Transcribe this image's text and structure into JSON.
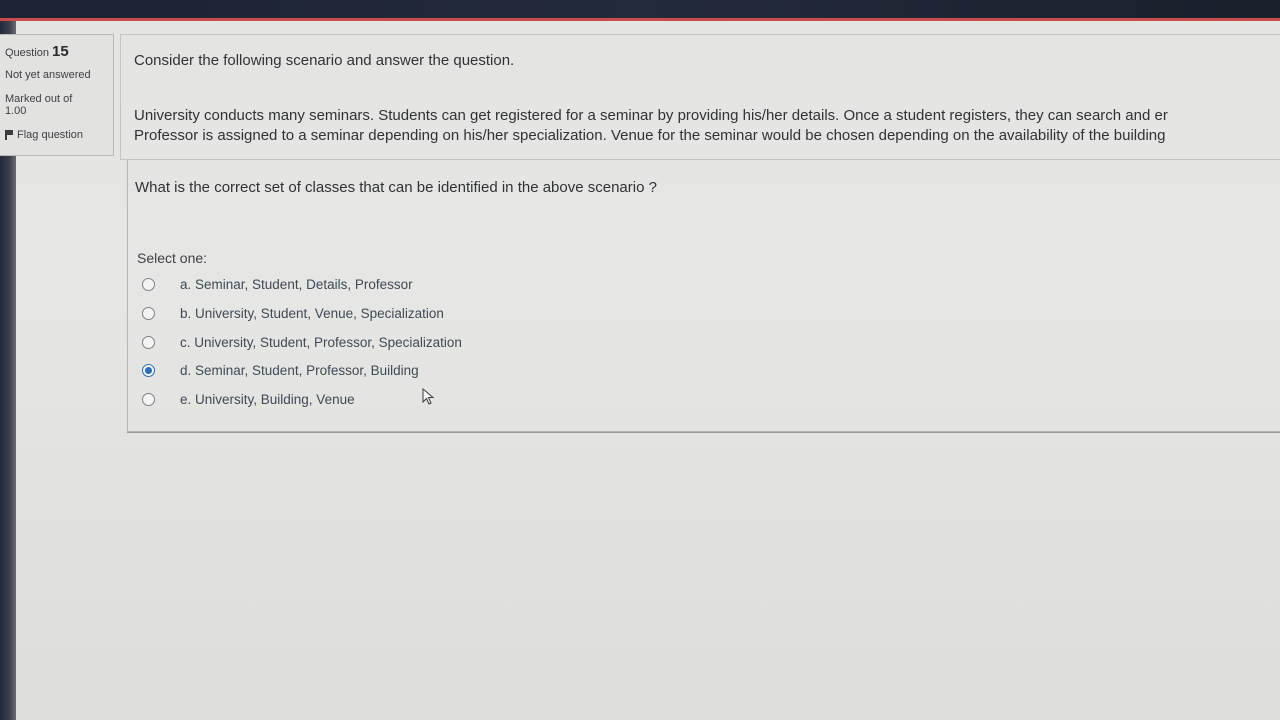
{
  "question_info": {
    "label": "Question",
    "number": "15",
    "status": "Not yet answered",
    "marked_line1": "Marked out of",
    "marked_line2": "1.00",
    "flag_label": "Flag question"
  },
  "question": {
    "intro": "Consider the following scenario and answer the question.",
    "scenario_line1": "University conducts many seminars.  Students can get registered for a seminar by providing his/her details.  Once a student registers, they can search and er",
    "scenario_line2": "Professor is assigned to a seminar depending on his/her specialization.  Venue for the seminar would be chosen depending on the availability of the building",
    "prompt": "What is the correct set of classes that can be identified in the above scenario ?"
  },
  "answer": {
    "select_label": "Select one:",
    "selected": "d",
    "options": [
      {
        "id": "a",
        "label": "a. Seminar, Student, Details, Professor"
      },
      {
        "id": "b",
        "label": "b. University, Student, Venue, Specialization"
      },
      {
        "id": "c",
        "label": "c. University, Student, Professor, Specialization"
      },
      {
        "id": "d",
        "label": "d. Seminar, Student, Professor, Building"
      },
      {
        "id": "e",
        "label": "e. University, Building, Venue"
      }
    ]
  },
  "colors": {
    "accent_bar": "#c94b4b",
    "radio_selected": "#2a6ebd",
    "option_text": "#3e4a56"
  }
}
